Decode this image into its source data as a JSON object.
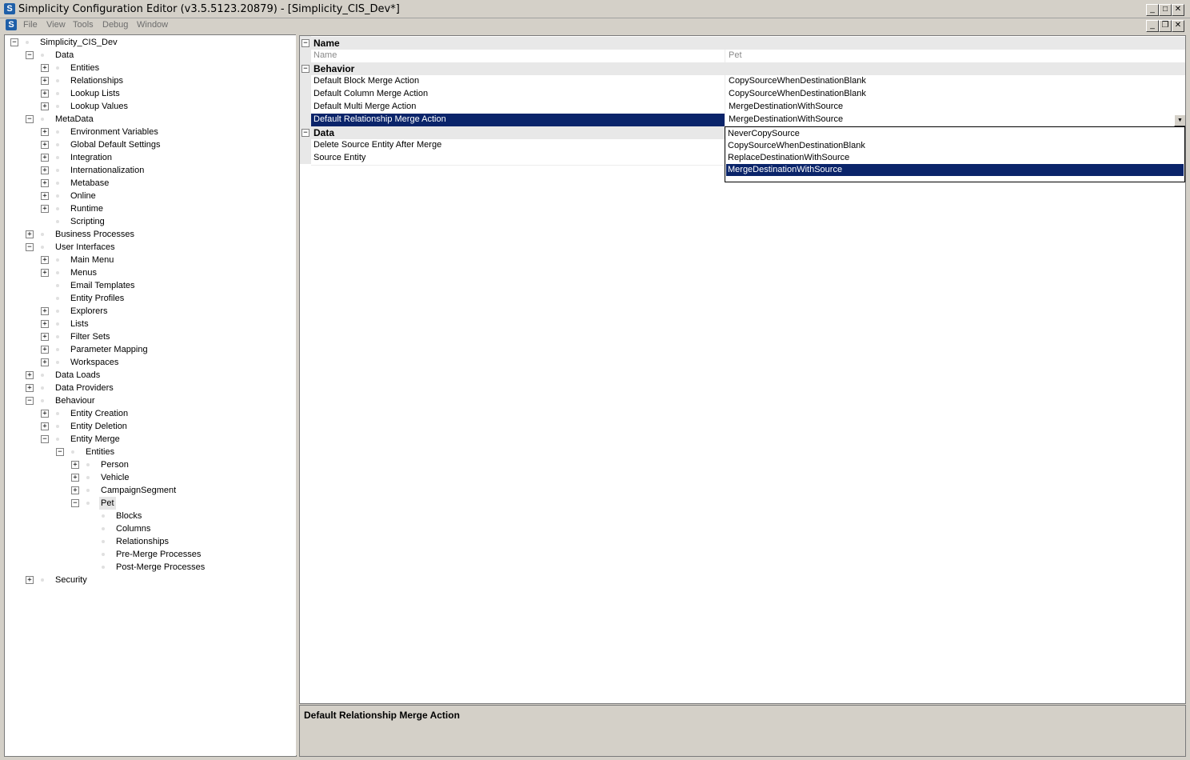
{
  "window": {
    "title": "Simplicity Configuration Editor (v3.5.5123.20879) - [Simplicity_CIS_Dev*]",
    "app_icon_letter": "S",
    "buttons": [
      "minimize",
      "maximize",
      "close"
    ]
  },
  "menu": {
    "items": [
      "File",
      "View",
      "Tools",
      "Debug",
      "Window"
    ]
  },
  "tree": {
    "root": "Simplicity_CIS_Dev",
    "nodes": [
      {
        "label": "Simplicity_CIS_Dev",
        "level": 0,
        "exp": "-"
      },
      {
        "label": "Data",
        "level": 1,
        "exp": "-"
      },
      {
        "label": "Entities",
        "level": 2,
        "exp": "+"
      },
      {
        "label": "Relationships",
        "level": 2,
        "exp": "+"
      },
      {
        "label": "Lookup Lists",
        "level": 2,
        "exp": "+"
      },
      {
        "label": "Lookup Values",
        "level": 2,
        "exp": "+"
      },
      {
        "label": "MetaData",
        "level": 1,
        "exp": "-"
      },
      {
        "label": "Environment Variables",
        "level": 2,
        "exp": "+"
      },
      {
        "label": "Global Default Settings",
        "level": 2,
        "exp": "+"
      },
      {
        "label": "Integration",
        "level": 2,
        "exp": "+"
      },
      {
        "label": "Internationalization",
        "level": 2,
        "exp": "+"
      },
      {
        "label": "Metabase",
        "level": 2,
        "exp": "+"
      },
      {
        "label": "Online",
        "level": 2,
        "exp": "+"
      },
      {
        "label": "Runtime",
        "level": 2,
        "exp": "+"
      },
      {
        "label": "Scripting",
        "level": 2,
        "exp": ""
      },
      {
        "label": "Business Processes",
        "level": 1,
        "exp": "+"
      },
      {
        "label": "User Interfaces",
        "level": 1,
        "exp": "-"
      },
      {
        "label": "Main Menu",
        "level": 2,
        "exp": "+"
      },
      {
        "label": "Menus",
        "level": 2,
        "exp": "+"
      },
      {
        "label": "Email Templates",
        "level": 2,
        "exp": ""
      },
      {
        "label": "Entity Profiles",
        "level": 2,
        "exp": ""
      },
      {
        "label": "Explorers",
        "level": 2,
        "exp": "+"
      },
      {
        "label": "Lists",
        "level": 2,
        "exp": "+"
      },
      {
        "label": "Filter Sets",
        "level": 2,
        "exp": "+"
      },
      {
        "label": "Parameter Mapping",
        "level": 2,
        "exp": "+"
      },
      {
        "label": "Workspaces",
        "level": 2,
        "exp": "+"
      },
      {
        "label": "Data Loads",
        "level": 1,
        "exp": "+"
      },
      {
        "label": "Data Providers",
        "level": 1,
        "exp": "+"
      },
      {
        "label": "Behaviour",
        "level": 1,
        "exp": "-"
      },
      {
        "label": "Entity Creation",
        "level": 2,
        "exp": "+"
      },
      {
        "label": "Entity Deletion",
        "level": 2,
        "exp": "+"
      },
      {
        "label": "Entity Merge",
        "level": 2,
        "exp": "-"
      },
      {
        "label": "Entities",
        "level": 3,
        "exp": "-"
      },
      {
        "label": "Person",
        "level": 4,
        "exp": "+"
      },
      {
        "label": "Vehicle",
        "level": 4,
        "exp": "+"
      },
      {
        "label": "CampaignSegment",
        "level": 4,
        "exp": "+"
      },
      {
        "label": "Pet",
        "level": 4,
        "exp": "-",
        "selected": true
      },
      {
        "label": "Blocks",
        "level": 5,
        "exp": ""
      },
      {
        "label": "Columns",
        "level": 5,
        "exp": ""
      },
      {
        "label": "Relationships",
        "level": 5,
        "exp": ""
      },
      {
        "label": "Pre-Merge Processes",
        "level": 5,
        "exp": ""
      },
      {
        "label": "Post-Merge Processes",
        "level": 5,
        "exp": ""
      },
      {
        "label": "Security",
        "level": 1,
        "exp": "+"
      }
    ]
  },
  "properties": {
    "categories": [
      {
        "name": "Name",
        "rows": [
          {
            "name": "Name",
            "value": "Pet",
            "disabled": true
          }
        ]
      },
      {
        "name": "Behavior",
        "rows": [
          {
            "name": "Default Block Merge Action",
            "value": "CopySourceWhenDestinationBlank"
          },
          {
            "name": "Default Column Merge Action",
            "value": "CopySourceWhenDestinationBlank"
          },
          {
            "name": "Default Multi Merge Action",
            "value": "MergeDestinationWithSource"
          },
          {
            "name": "Default Relationship Merge Action",
            "value": "MergeDestinationWithSource",
            "selected": true
          }
        ]
      },
      {
        "name": "Data",
        "rows": [
          {
            "name": "Delete Source Entity After Merge",
            "value": ""
          },
          {
            "name": "Source Entity",
            "value": ""
          }
        ]
      }
    ],
    "dropdown": {
      "options": [
        "NeverCopySource",
        "CopySourceWhenDestinationBlank",
        "ReplaceDestinationWithSource",
        "MergeDestinationWithSource"
      ],
      "selected_index": 3
    }
  },
  "help": {
    "title": "Default Relationship Merge Action"
  },
  "colors": {
    "selection": "#0a246a",
    "chrome": "#d4d0c8"
  }
}
